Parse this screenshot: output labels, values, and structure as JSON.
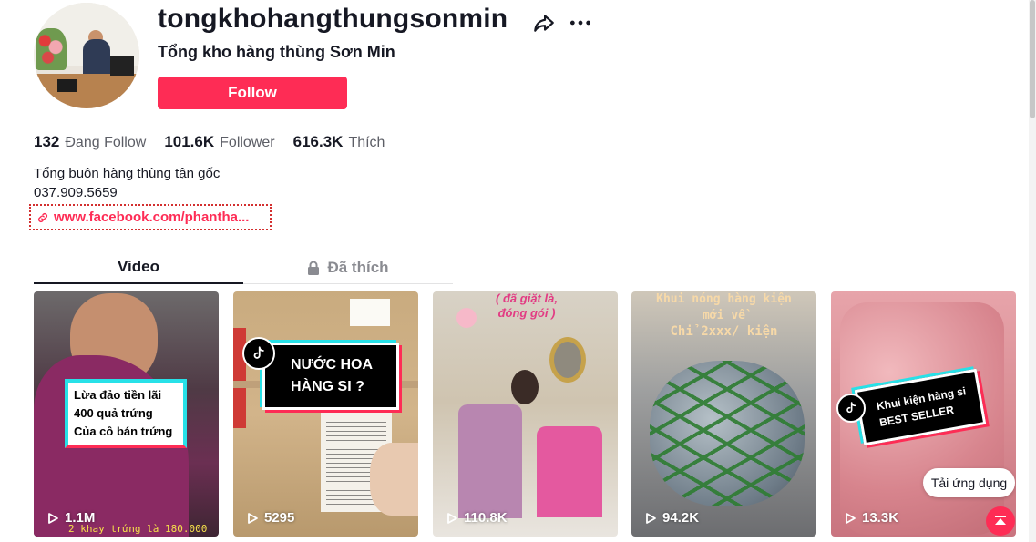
{
  "profile": {
    "username": "tongkhohangthungsonmin",
    "nickname": "Tổng kho hàng thùng Sơn Min",
    "follow_label": "Follow"
  },
  "stats": [
    {
      "value": "132",
      "label": "Đang Follow"
    },
    {
      "value": "101.6K",
      "label": "Follower"
    },
    {
      "value": "616.3K",
      "label": "Thích"
    }
  ],
  "bio": {
    "line1": "Tổng buôn hàng thùng tận gốc",
    "line2": "037.909.5659",
    "link": "www.facebook.com/phantha..."
  },
  "tabs": {
    "video": "Video",
    "liked": "Đã thích"
  },
  "videos": [
    {
      "views": "1.1M",
      "caption_lines": [
        "Lừa đảo tiền lãi",
        "400 quả trứng",
        "Của cô bán trứng"
      ],
      "subtitle": "2 khay trứng là 180.000"
    },
    {
      "views": "5295",
      "caption_lines": [
        "NƯỚC HOA",
        "HÀNG SI ?"
      ]
    },
    {
      "views": "110.8K",
      "caption_lines": [
        "( đã giặt là,",
        "đóng gói )"
      ]
    },
    {
      "views": "94.2K",
      "caption_lines": [
        "Khui nóng hàng kiện",
        "mới về",
        "Chỉ 2xxx/ kiện"
      ]
    },
    {
      "views": "13.3K",
      "caption_lines": [
        "Khui kiện hàng si",
        "BEST SELLER"
      ]
    }
  ],
  "app_button": "Tải ứng dụng",
  "colors": {
    "accent": "#fe2c55",
    "text": "#161823",
    "muted": "#5c5e66"
  },
  "icons": [
    "share-icon",
    "more-icon",
    "link-icon",
    "lock-icon",
    "play-icon",
    "tiktok-logo-icon",
    "arrow-up-icon"
  ]
}
